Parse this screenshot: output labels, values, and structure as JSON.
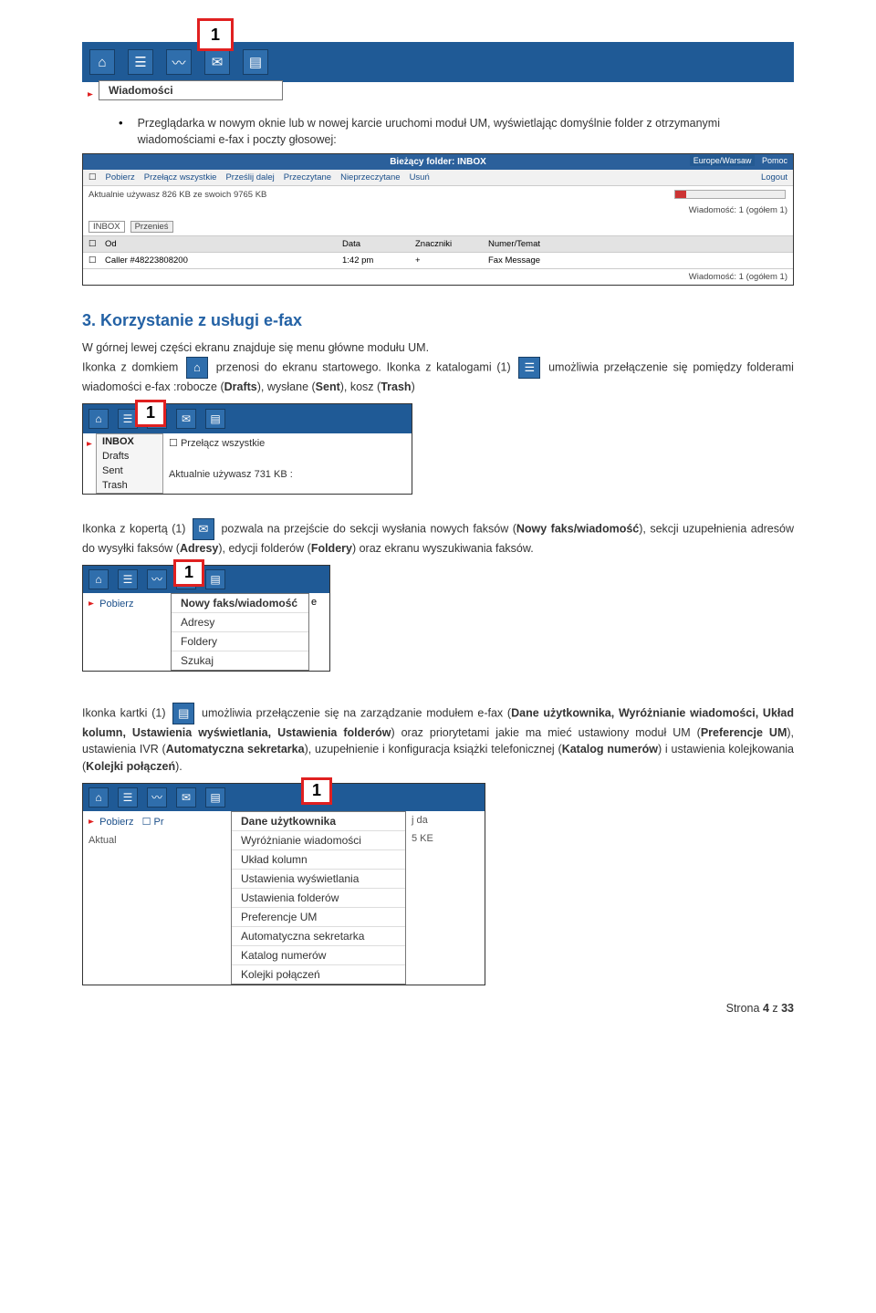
{
  "callouts": {
    "n1": "1"
  },
  "menus": {
    "wiadomosci": "Wiadomości",
    "folders": [
      "INBOX",
      "Drafts",
      "Sent",
      "Trash"
    ],
    "compose": [
      "Nowy faks/wiadomość",
      "Adresy",
      "Foldery",
      "Szukaj"
    ],
    "settings": [
      "Dane użytkownika",
      "Wyróżnianie wiadomości",
      "Układ kolumn",
      "Ustawienia wyświetlania",
      "Ustawienia folderów",
      "Preferencje UM",
      "Automatyczna sekretarka",
      "Katalog numerów",
      "Kolejki połączeń"
    ]
  },
  "s1": {
    "bullet": "Przeglądarka w nowym oknie lub w nowej karcie uruchomi moduł UM, wyświetlając domyślnie folder z otrzymanymi wiadomościami e-fax i poczty głosowej:"
  },
  "inbox": {
    "header": "Bieżący folder: INBOX",
    "right1": "Europe/Warsaw",
    "right2": "Pomoc",
    "tools": {
      "pobierz": "Pobierz",
      "przelacz": "Przełącz wszystkie",
      "przeslij": "Prześlij dalej",
      "przeczytane": "Przeczytane",
      "nieprzeczytane": "Nieprzeczytane",
      "usun": "Usuń",
      "logout": "Logout"
    },
    "usage": "Aktualnie używasz 826 KB ze swoich 9765 KB",
    "count": "Wiadomość: 1 (ogółem 1)",
    "selector": {
      "inbox": "INBOX",
      "btn": "Przenieś"
    },
    "cols": {
      "od": "Od",
      "data": "Data",
      "znaczniki": "Znaczniki",
      "temat": "Numer/Temat"
    },
    "row": {
      "od": "Caller #48223808200",
      "data": "1:42 pm",
      "zn": "+",
      "temat": "Fax Message"
    }
  },
  "s3": {
    "title": "3. Korzystanie z usługi e-fax",
    "p1a": "W górnej lewej części ekranu znajduje się menu główne modułu UM.",
    "p1b": "Ikonka z domkiem",
    "p1c": "przenosi do ekranu startowego. Ikonka z katalogami (1)",
    "p1d": "umożliwia przełączenie się pomiędzy folderami wiadomości e-fax :robocze (",
    "p1e": "), wysłane (",
    "p1f": "), kosz (",
    "p1g": ")",
    "drafts": "Drafts",
    "sent": "Sent",
    "trash": "Trash",
    "usage2": "Aktualnie używasz 731 KB :",
    "przelacz": "Przełącz wszystkie",
    "p2a": "Ikonka z kopertą (1)",
    "p2b": "pozwala na przejście do sekcji wysłania nowych faksów (",
    "p2c": "Nowy faks/wiadomość",
    "p2d": "), sekcji uzupełnienia adresów do wysyłki faksów (",
    "p2e": "Adresy",
    "p2f": "), edycji folderów (",
    "p2g": "Foldery",
    "p2h": ") oraz ekranu wyszukiwania faksów.",
    "p3a": "Ikonka kartki (1)",
    "p3b": "umożliwia przełączenie się na zarządzanie modułem e-fax (",
    "p3c": "Dane użytkownika, Wyróżnianie wiadomości, Układ kolumn, Ustawienia wyświetlania, Ustawienia folderów",
    "p3d": ") oraz priorytetami jakie ma mieć ustawiony moduł UM (",
    "p3e": "Preferencje UM",
    "p3f": "), ustawienia IVR (",
    "p3g": "Automatyczna sekretarka",
    "p3h": "), uzupełnienie i konfiguracja książki telefonicznej (",
    "p3i": "Katalog numerów",
    "p3j": ") i ustawienia kolejkowania (",
    "p3k": "Kolejki połączeń",
    "p3l": ")."
  },
  "footer": {
    "label": "Strona ",
    "n": "4",
    "of": " z ",
    "total": "33"
  },
  "tool": {
    "pobierz": "Pobierz",
    "pr": "Pr",
    "jda": "j da",
    "kb5": "5 KE"
  }
}
